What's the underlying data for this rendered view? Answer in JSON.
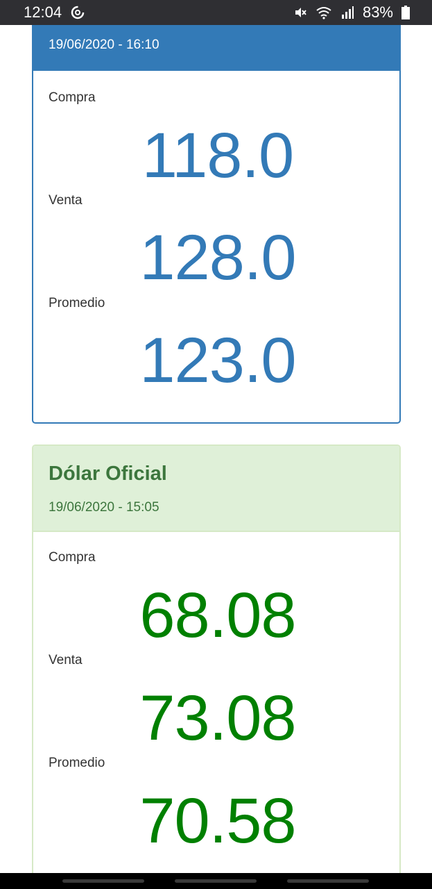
{
  "status_bar": {
    "time": "12:04",
    "battery": "83%"
  },
  "cards": [
    {
      "title": "",
      "date": "19/06/2020 - 16:10",
      "compra_label": "Compra",
      "compra_value": "118.0",
      "venta_label": "Venta",
      "venta_value": "128.0",
      "promedio_label": "Promedio",
      "promedio_value": "123.0",
      "accent": "#337ab7"
    },
    {
      "title": "Dólar Oficial",
      "date": "19/06/2020 - 15:05",
      "compra_label": "Compra",
      "compra_value": "68.08",
      "venta_label": "Venta",
      "venta_value": "73.08",
      "promedio_label": "Promedio",
      "promedio_value": "70.58",
      "accent": "#008000"
    }
  ],
  "icons": [
    "sync-icon",
    "mute-icon",
    "wifi-icon",
    "signal-icon",
    "battery-icon"
  ]
}
